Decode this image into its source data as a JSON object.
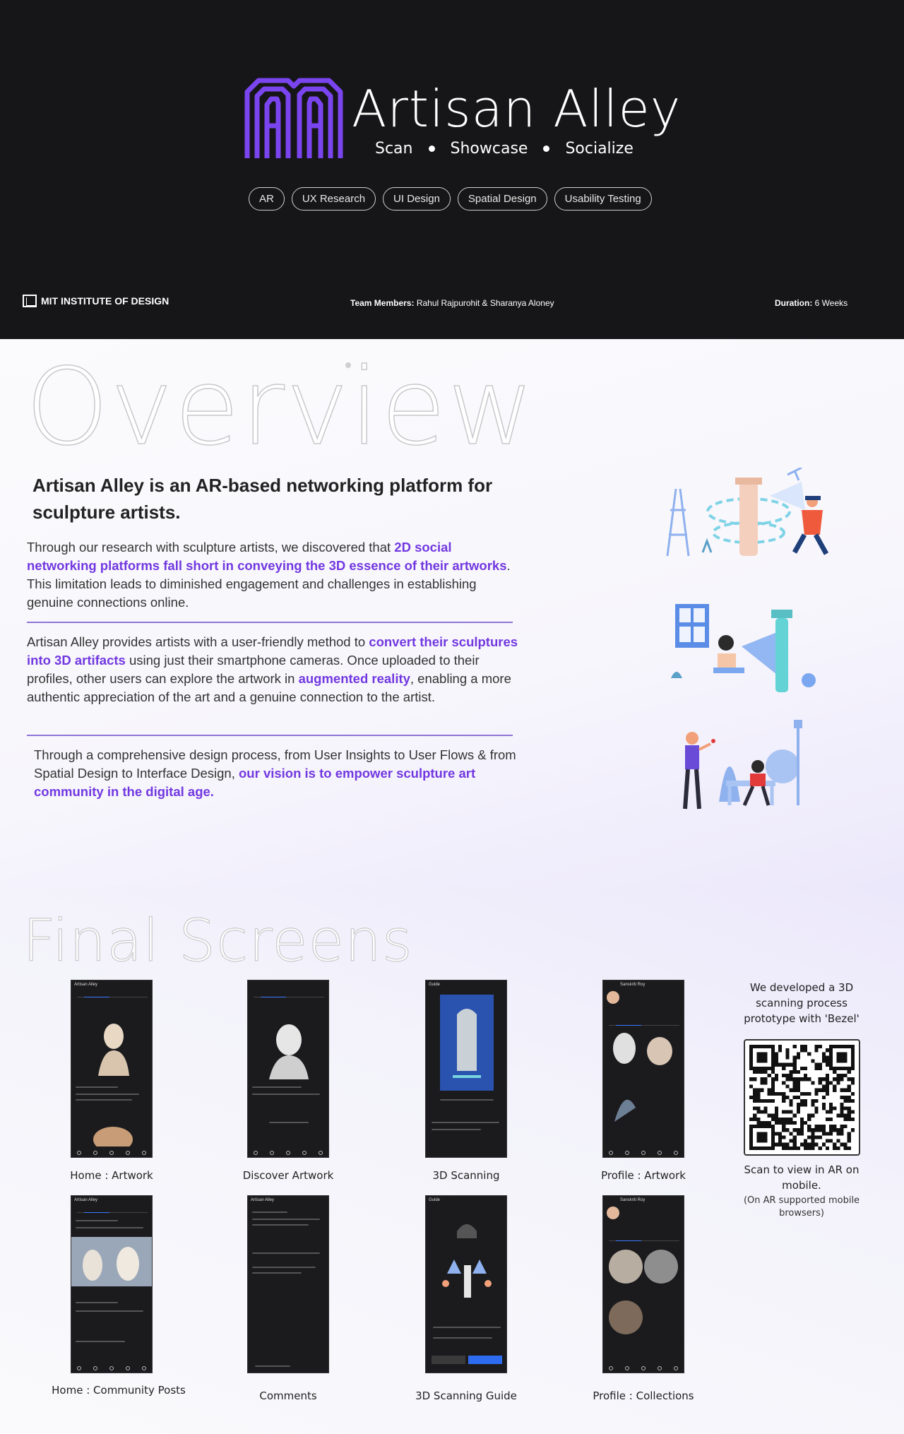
{
  "hero": {
    "title": "Artisan Alley",
    "tagline": [
      "Scan",
      "Showcase",
      "Socialize"
    ],
    "tags": [
      "AR",
      "UX Research",
      "UI Design",
      "Spatial Design",
      "Usability Testing"
    ],
    "institute": "MIT INSTITUTE OF DESIGN",
    "team_label": "Team Members:",
    "team_value": "Rahul Rajpurohit & Sharanya Aloney",
    "duration_label": "Duration:",
    "duration_value": "6 Weeks"
  },
  "overview": {
    "title": "Overview",
    "headline": "Artisan Alley is an AR-based networking platform for sculpture artists.",
    "p1": [
      {
        "t": "Through our research with sculpture artists, we discovered that ",
        "hl": false
      },
      {
        "t": "2D social networking platforms fall short in conveying the 3D essence of their artworks",
        "hl": true
      },
      {
        "t": ". This limitation leads to diminished engagement and challenges in establishing genuine connections online.",
        "hl": false
      }
    ],
    "p2": [
      {
        "t": "Artisan Alley provides artists with a user-friendly method to ",
        "hl": false
      },
      {
        "t": "convert their sculptures into 3D artifacts",
        "hl": true
      },
      {
        "t": " using just their smartphone cameras. Once uploaded to their profiles, other users can explore the artwork in ",
        "hl": false
      },
      {
        "t": "augmented reality",
        "hl": true
      },
      {
        "t": ", enabling a more authentic appreciation of the art and a genuine connection to the artist.",
        "hl": false
      }
    ],
    "p3": [
      {
        "t": "Through a comprehensive design process, from User Insights to User Flows & from Spatial Design to Interface Design, ",
        "hl": false
      },
      {
        "t": "our vision is to empower sculpture art community in the digital age.",
        "hl": true
      }
    ]
  },
  "screens": {
    "title": "Final Screens",
    "items": [
      {
        "caption": "Home : Artwork",
        "app": "Artisan Alley"
      },
      {
        "caption": "Discover Artwork",
        "app": ""
      },
      {
        "caption": "3D Scanning",
        "app": "Guide"
      },
      {
        "caption": "Profile : Artwork",
        "app": "Sanskriti Roy"
      },
      {
        "caption": "Home : Community Posts",
        "app": "Artisan Alley"
      },
      {
        "caption": "Comments",
        "app": "Artisan Alley"
      },
      {
        "caption": "3D Scanning Guide",
        "app": "Guide"
      },
      {
        "caption": "Profile : Collections",
        "app": "Sanskriti Roy"
      }
    ],
    "qr_text": "We developed a 3D scanning process prototype with 'Bezel'",
    "qr_scan": "Scan to view in AR on mobile.",
    "qr_note": "(On AR supported mobile browsers)"
  },
  "colors": {
    "accent": "#7238e0",
    "hero_bg": "#161517",
    "logo": "#7a45ef"
  }
}
